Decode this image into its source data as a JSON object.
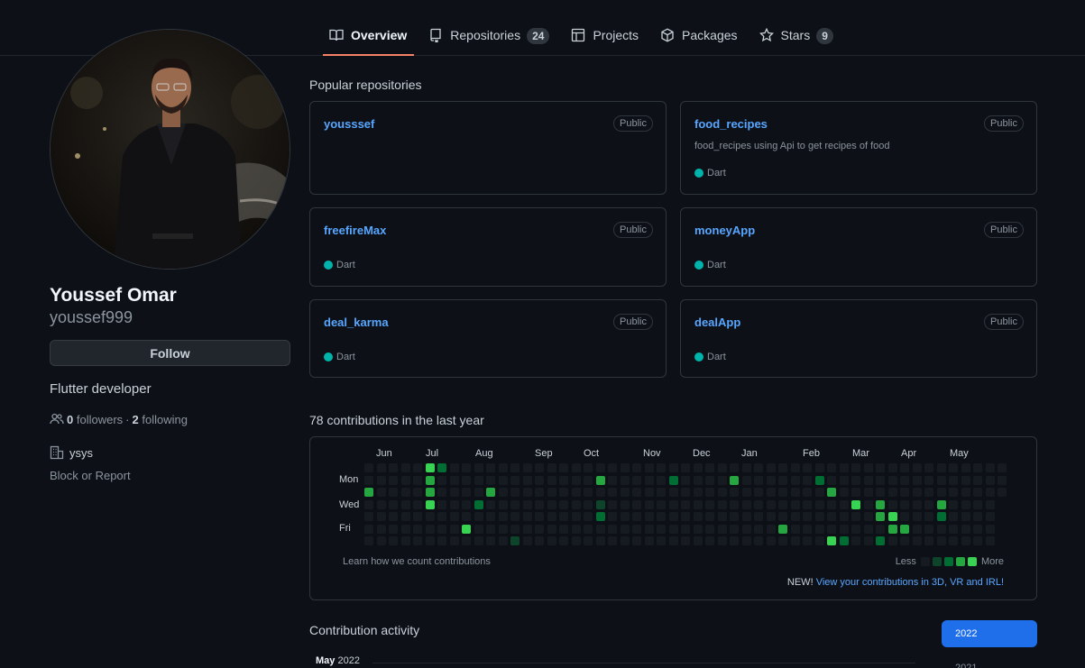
{
  "nav": {
    "tabs": [
      {
        "label": "Overview",
        "icon": "book-icon"
      },
      {
        "label": "Repositories",
        "icon": "repo-icon",
        "count": "24"
      },
      {
        "label": "Projects",
        "icon": "table-icon"
      },
      {
        "label": "Packages",
        "icon": "package-icon"
      },
      {
        "label": "Stars",
        "icon": "star-icon",
        "count": "9"
      }
    ]
  },
  "profile": {
    "name": "Youssef Omar",
    "login": "youssef999",
    "follow_label": "Follow",
    "bio": "Flutter developer",
    "followers_count": "0",
    "followers_label": "followers",
    "separator": "·",
    "following_count": "2",
    "following_label": "following",
    "org": "ysys",
    "block_label": "Block or Report"
  },
  "popular": {
    "title": "Popular repositories",
    "repos": [
      {
        "name": "yousssef",
        "visibility": "Public",
        "description": "",
        "language": ""
      },
      {
        "name": "food_recipes",
        "visibility": "Public",
        "description": "food_recipes using Api to get recipes of food",
        "language": "Dart"
      },
      {
        "name": "freefireMax",
        "visibility": "Public",
        "description": "",
        "language": "Dart"
      },
      {
        "name": "moneyApp",
        "visibility": "Public",
        "description": "",
        "language": "Dart"
      },
      {
        "name": "deal_karma",
        "visibility": "Public",
        "description": "",
        "language": "Dart"
      },
      {
        "name": "dealApp",
        "visibility": "Public",
        "description": "",
        "language": "Dart"
      }
    ],
    "dart_color": "#00b4ab"
  },
  "contributions": {
    "title": "78 contributions in the last year",
    "months": [
      "Jun",
      "Jul",
      "Aug",
      "Sep",
      "Oct",
      "Nov",
      "Dec",
      "Jan",
      "Feb",
      "Mar",
      "Apr",
      "May"
    ],
    "day_labels": [
      "Mon",
      "Wed",
      "Fri"
    ],
    "learn_label": "Learn how we count contributions",
    "legend_less": "Less",
    "legend_more": "More",
    "new_prefix": "NEW!",
    "new_link": "View your contributions in 3D, VR and IRL!",
    "colors": [
      "#161b22",
      "#0e4429",
      "#006d32",
      "#26a641",
      "#39d353"
    ]
  },
  "activity": {
    "title": "Contribution activity",
    "month_bold": "May",
    "month_year": "2022",
    "years": [
      "2022",
      "2021"
    ]
  }
}
